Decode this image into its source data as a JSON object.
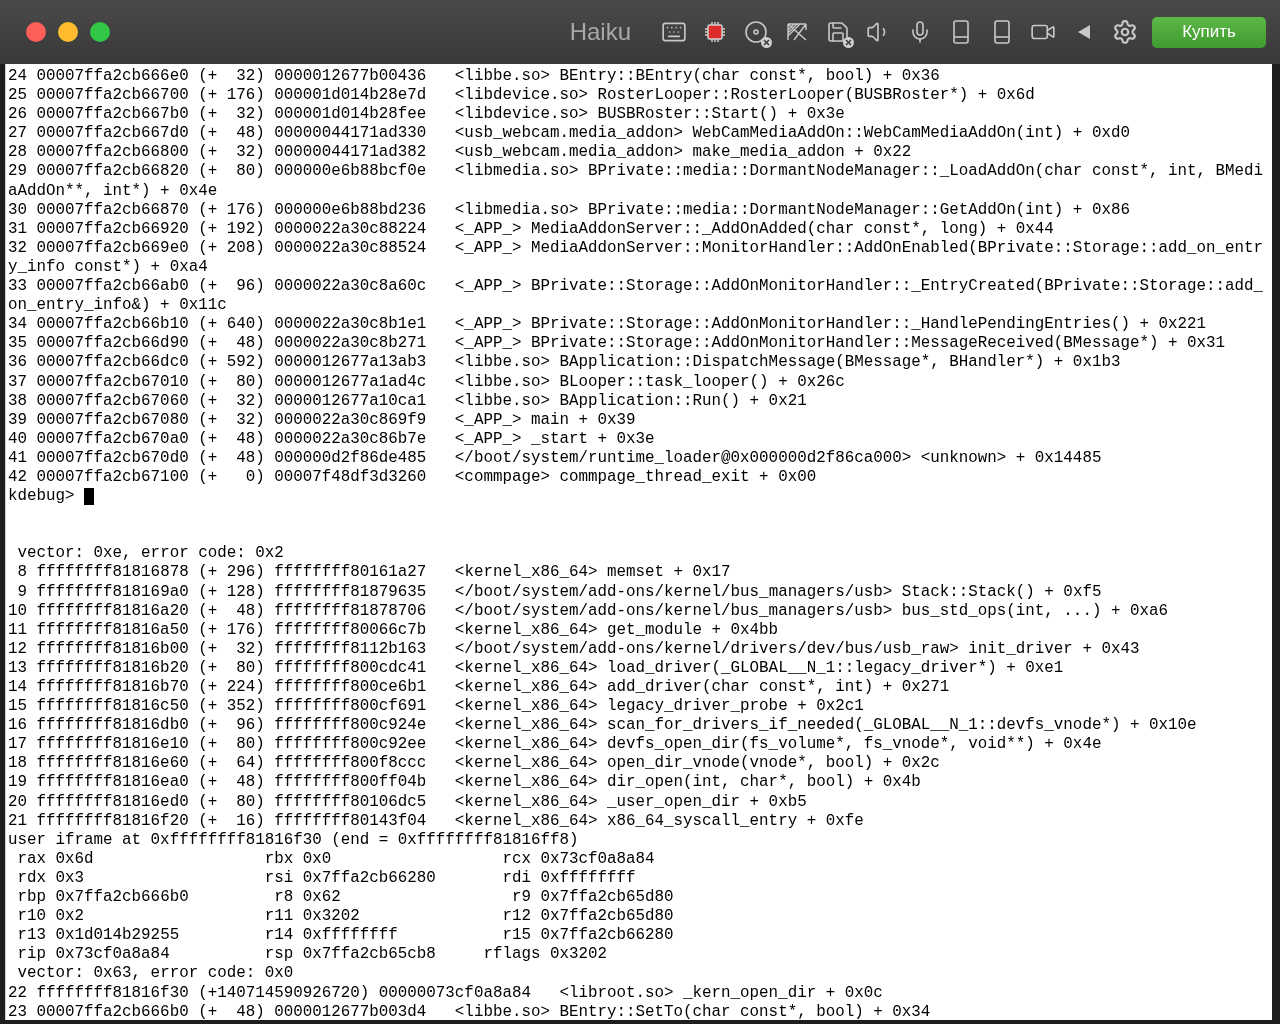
{
  "window": {
    "title": "Haiku",
    "buy_button": "Купить"
  },
  "terminal": {
    "lines": [
      {
        "kind": "output",
        "text": "24 00007ffa2cb666e0 (+  32) 0000012677b00436   <libbe.so> BEntry::BEntry(char const*, bool) + 0x36"
      },
      {
        "kind": "output",
        "text": "25 00007ffa2cb66700 (+ 176) 000001d014b28e7d   <libdevice.so> RosterLooper::RosterLooper(BUSBRoster*) + 0x6d"
      },
      {
        "kind": "output",
        "text": "26 00007ffa2cb667b0 (+  32) 000001d014b28fee   <libdevice.so> BUSBRoster::Start() + 0x3e"
      },
      {
        "kind": "output",
        "text": "27 00007ffa2cb667d0 (+  48) 00000044171ad330   <usb_webcam.media_addon> WebCamMediaAddOn::WebCamMediaAddOn(int) + 0xd0"
      },
      {
        "kind": "output",
        "text": "28 00007ffa2cb66800 (+  32) 00000044171ad382   <usb_webcam.media_addon> make_media_addon + 0x22"
      },
      {
        "kind": "output",
        "text": "29 00007ffa2cb66820 (+  80) 000000e6b88bcf0e   <libmedia.so> BPrivate::media::DormantNodeManager::_LoadAddOn(char const*, int, BMediaAddOn**, int*) + 0x4e"
      },
      {
        "kind": "output",
        "text": "30 00007ffa2cb66870 (+ 176) 000000e6b88bd236   <libmedia.so> BPrivate::media::DormantNodeManager::GetAddOn(int) + 0x86"
      },
      {
        "kind": "output",
        "text": "31 00007ffa2cb66920 (+ 192) 0000022a30c88224   <_APP_> MediaAddonServer::_AddOnAdded(char const*, long) + 0x44"
      },
      {
        "kind": "output",
        "text": "32 00007ffa2cb669e0 (+ 208) 0000022a30c88524   <_APP_> MediaAddonServer::MonitorHandler::AddOnEnabled(BPrivate::Storage::add_on_entry_info const*) + 0xa4"
      },
      {
        "kind": "output",
        "text": "33 00007ffa2cb66ab0 (+  96) 0000022a30c8a60c   <_APP_> BPrivate::Storage::AddOnMonitorHandler::_EntryCreated(BPrivate::Storage::add_on_entry_info&) + 0x11c"
      },
      {
        "kind": "output",
        "text": "34 00007ffa2cb66b10 (+ 640) 0000022a30c8b1e1   <_APP_> BPrivate::Storage::AddOnMonitorHandler::_HandlePendingEntries() + 0x221"
      },
      {
        "kind": "output",
        "text": "35 00007ffa2cb66d90 (+  48) 0000022a30c8b271   <_APP_> BPrivate::Storage::AddOnMonitorHandler::MessageReceived(BMessage*) + 0x31"
      },
      {
        "kind": "output",
        "text": "36 00007ffa2cb66dc0 (+ 592) 0000012677a13ab3   <libbe.so> BApplication::DispatchMessage(BMessage*, BHandler*) + 0x1b3"
      },
      {
        "kind": "output",
        "text": "37 00007ffa2cb67010 (+  80) 0000012677a1ad4c   <libbe.so> BLooper::task_looper() + 0x26c"
      },
      {
        "kind": "output",
        "text": "38 00007ffa2cb67060 (+  32) 0000012677a10ca1   <libbe.so> BApplication::Run() + 0x21"
      },
      {
        "kind": "output",
        "text": "39 00007ffa2cb67080 (+  32) 0000022a30c869f9   <_APP_> main + 0x39"
      },
      {
        "kind": "output",
        "text": "40 00007ffa2cb670a0 (+  48) 0000022a30c86b7e   <_APP_> _start + 0x3e"
      },
      {
        "kind": "output",
        "text": "41 00007ffa2cb670d0 (+  48) 000000d2f86de485   </boot/system/runtime_loader@0x000000d2f86ca000> <unknown> + 0x14485"
      },
      {
        "kind": "output",
        "text": "42 00007ffa2cb67100 (+   0) 00007f48df3d3260   <commpage> commpage_thread_exit + 0x00"
      },
      {
        "kind": "prompt",
        "text": "kdebug>",
        "cursor": true
      },
      {
        "kind": "blank"
      },
      {
        "kind": "blank"
      },
      {
        "kind": "output",
        "text": " vector: 0xe, error code: 0x2"
      },
      {
        "kind": "output",
        "text": " 8 ffffffff81816878 (+ 296) ffffffff80161a27   <kernel_x86_64> memset + 0x17"
      },
      {
        "kind": "output",
        "text": " 9 ffffffff818169a0 (+ 128) ffffffff81879635   </boot/system/add-ons/kernel/bus_managers/usb> Stack::Stack() + 0xf5"
      },
      {
        "kind": "output",
        "text": "10 ffffffff81816a20 (+  48) ffffffff81878706   </boot/system/add-ons/kernel/bus_managers/usb> bus_std_ops(int, ...) + 0xa6"
      },
      {
        "kind": "output",
        "text": "11 ffffffff81816a50 (+ 176) ffffffff80066c7b   <kernel_x86_64> get_module + 0x4bb"
      },
      {
        "kind": "output",
        "text": "12 ffffffff81816b00 (+  32) ffffffff8112b163   </boot/system/add-ons/kernel/drivers/dev/bus/usb_raw> init_driver + 0x43"
      },
      {
        "kind": "output",
        "text": "13 ffffffff81816b20 (+  80) ffffffff800cdc41   <kernel_x86_64> load_driver(_GLOBAL__N_1::legacy_driver*) + 0xe1"
      },
      {
        "kind": "output",
        "text": "14 ffffffff81816b70 (+ 224) ffffffff800ce6b1   <kernel_x86_64> add_driver(char const*, int) + 0x271"
      },
      {
        "kind": "output",
        "text": "15 ffffffff81816c50 (+ 352) ffffffff800cf691   <kernel_x86_64> legacy_driver_probe + 0x2c1"
      },
      {
        "kind": "output",
        "text": "16 ffffffff81816db0 (+  96) ffffffff800c924e   <kernel_x86_64> scan_for_drivers_if_needed(_GLOBAL__N_1::devfs_vnode*) + 0x10e"
      },
      {
        "kind": "output",
        "text": "17 ffffffff81816e10 (+  80) ffffffff800c92ee   <kernel_x86_64> devfs_open_dir(fs_volume*, fs_vnode*, void**) + 0x4e"
      },
      {
        "kind": "output",
        "text": "18 ffffffff81816e60 (+  64) ffffffff800f8ccc   <kernel_x86_64> open_dir_vnode(vnode*, bool) + 0x2c"
      },
      {
        "kind": "output",
        "text": "19 ffffffff81816ea0 (+  48) ffffffff800ff04b   <kernel_x86_64> dir_open(int, char*, bool) + 0x4b"
      },
      {
        "kind": "output",
        "text": "20 ffffffff81816ed0 (+  80) ffffffff80106dc5   <kernel_x86_64> _user_open_dir + 0xb5"
      },
      {
        "kind": "output",
        "text": "21 ffffffff81816f20 (+  16) ffffffff80143f04   <kernel_x86_64> x86_64_syscall_entry + 0xfe"
      },
      {
        "kind": "output",
        "text": "user iframe at 0xffffffff81816f30 (end = 0xffffffff81816ff8)"
      },
      {
        "kind": "output",
        "text": " rax 0x6d                  rbx 0x0                  rcx 0x73cf0a8a84"
      },
      {
        "kind": "output",
        "text": " rdx 0x3                   rsi 0x7ffa2cb66280       rdi 0xffffffff"
      },
      {
        "kind": "output",
        "text": " rbp 0x7ffa2cb666b0         r8 0x62                  r9 0x7ffa2cb65d80"
      },
      {
        "kind": "output",
        "text": " r10 0x2                   r11 0x3202               r12 0x7ffa2cb65d80"
      },
      {
        "kind": "output",
        "text": " r13 0x1d014b29255         r14 0xffffffff           r15 0x7ffa2cb66280"
      },
      {
        "kind": "output",
        "text": " rip 0x73cf0a8a84          rsp 0x7ffa2cb65cb8     rflags 0x3202"
      },
      {
        "kind": "output",
        "text": " vector: 0x63, error code: 0x0"
      },
      {
        "kind": "output",
        "text": "22 ffffffff81816f30 (+140714590926720) 00000073cf0a8a84   <libroot.so> _kern_open_dir + 0x0c"
      },
      {
        "kind": "output",
        "text": "23 00007ffa2cb666b0 (+  48) 0000012677b003d4   <libbe.so> BEntry::SetTo(char const*, bool) + 0x34"
      }
    ]
  }
}
